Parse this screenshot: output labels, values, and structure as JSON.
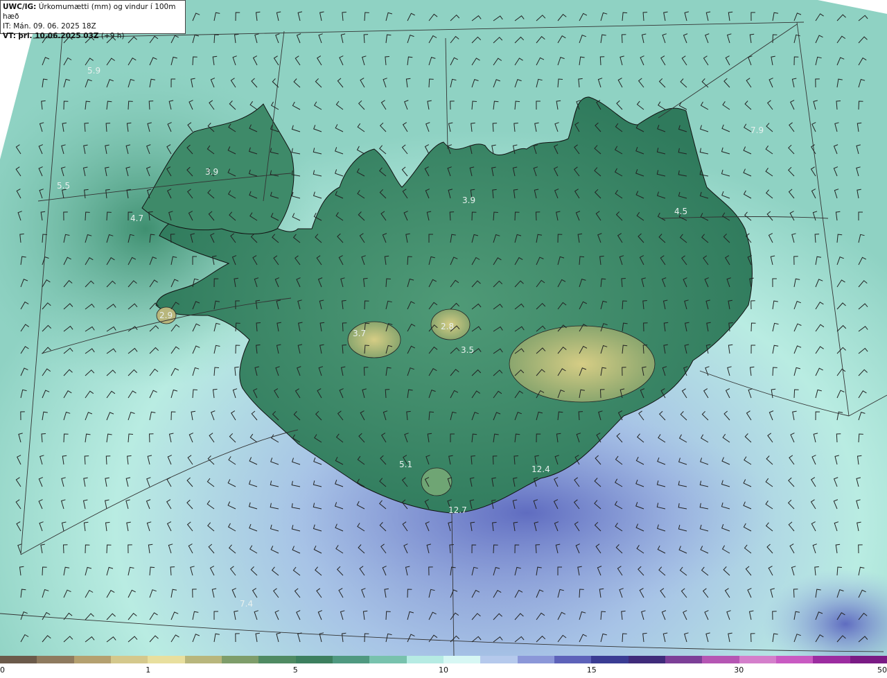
{
  "header": {
    "model_label": "UWC/IG:",
    "title": "Úrkomumætti (mm) og vindur í 100m hæð",
    "issue_time": "IT: Mán. 09. 06. 2025 18Z",
    "valid_prefix": "VT:",
    "valid_time": "þri. 10.06.2025 03Z",
    "lead": "(+9 h)"
  },
  "map": {
    "values": [
      "5.9",
      "5.5",
      "3.9",
      "4.7",
      "2.9",
      "3.7",
      "2.8",
      "3.9",
      "4.5",
      "7.9",
      "5.1",
      "12.4",
      "12.7",
      "7.4",
      "3.5"
    ]
  },
  "colorbar": {
    "colors": [
      "#6b5a4a",
      "#8e7a5e",
      "#b4a06f",
      "#d4c88c",
      "#e8df9e",
      "#b8b67c",
      "#7e9d6a",
      "#4f8a62",
      "#3c7f5e",
      "#4f9980",
      "#78c2ad",
      "#b6ebe3",
      "#d7f7f4",
      "#b5c9ec",
      "#8b97d8",
      "#5d62b9",
      "#3a3c93",
      "#3f2b7a",
      "#7c3f97",
      "#b556b3",
      "#d47fcb",
      "#c95ac2",
      "#9c2ca0",
      "#7a1a84"
    ],
    "ticks": [
      {
        "label": "0",
        "pos": 0
      },
      {
        "label": "1",
        "pos": 0.167
      },
      {
        "label": "5",
        "pos": 0.333
      },
      {
        "label": "10",
        "pos": 0.5
      },
      {
        "label": "15",
        "pos": 0.667
      },
      {
        "label": "30",
        "pos": 0.833
      },
      {
        "label": "50",
        "pos": 1.0
      }
    ]
  }
}
